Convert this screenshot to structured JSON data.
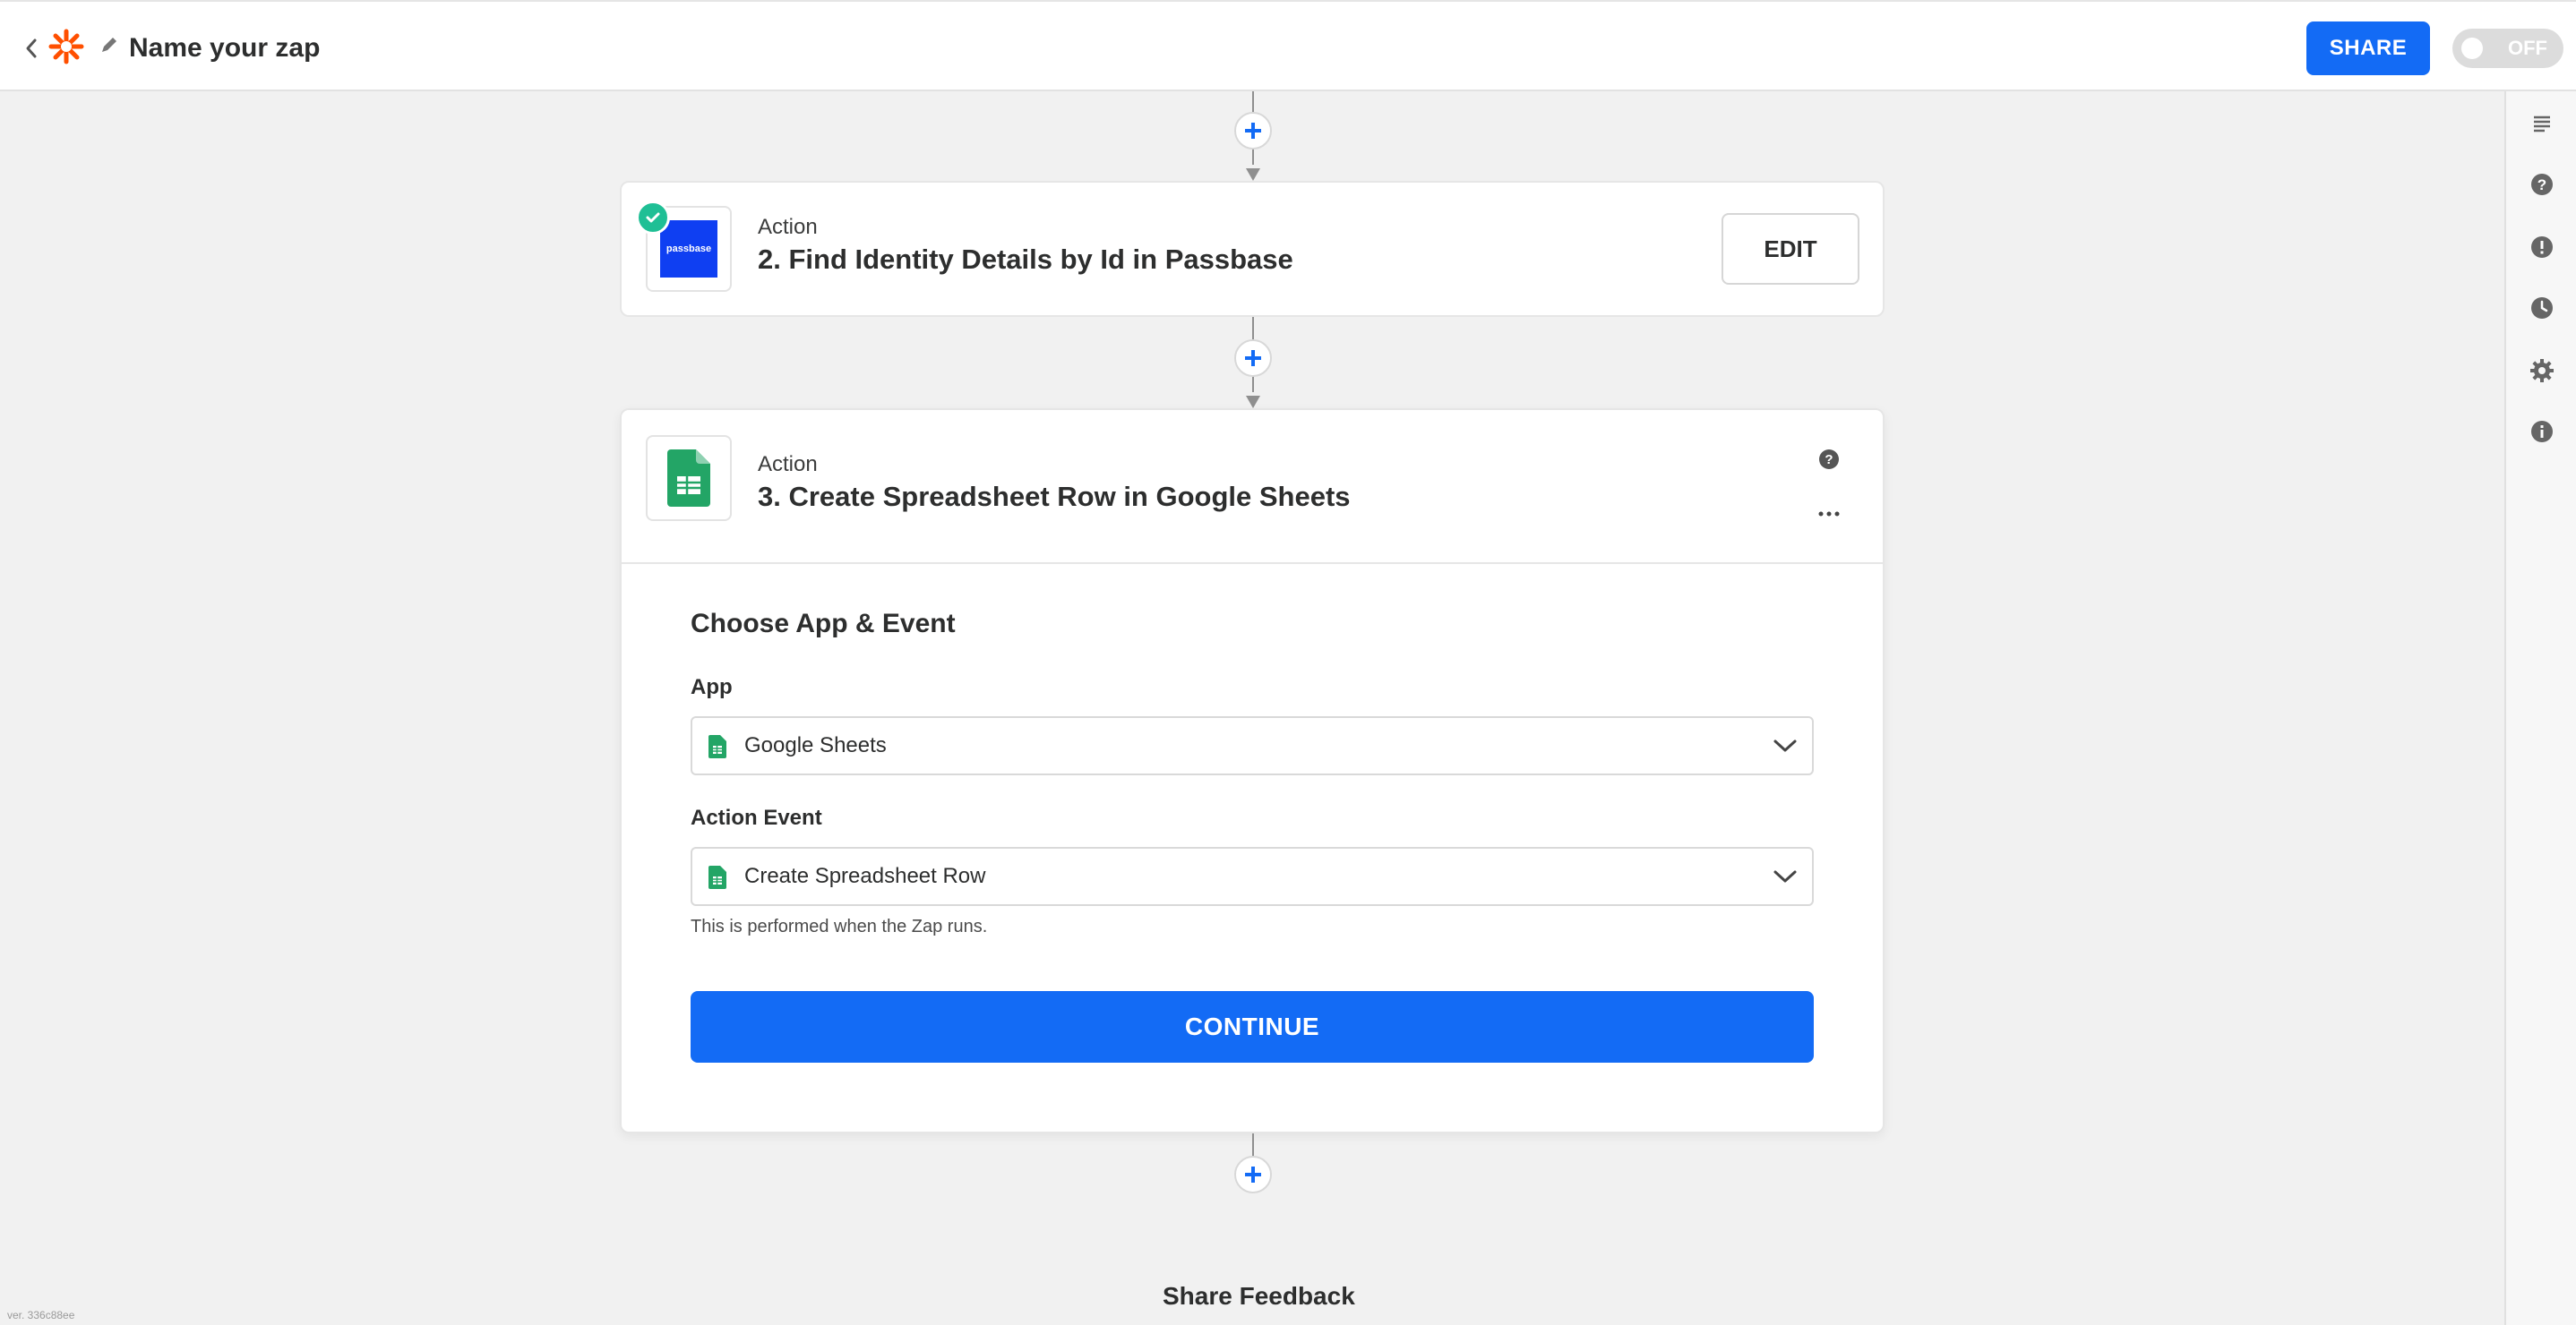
{
  "header": {
    "title": "Name your zap",
    "share_label": "SHARE",
    "toggle_label": "OFF",
    "accent": "#136bf5"
  },
  "steps": [
    {
      "type_label": "Action",
      "title": "2. Find Identity Details by Id in Passbase",
      "app_logo_text": "passbase",
      "status": "complete",
      "edit_label": "EDIT"
    },
    {
      "type_label": "Action",
      "title": "3. Create Spreadsheet Row in Google Sheets",
      "section_title": "Choose App & Event",
      "app_field": {
        "label": "App",
        "value": "Google Sheets"
      },
      "event_field": {
        "label": "Action Event",
        "value": "Create Spreadsheet Row",
        "hint": "This is performed when the Zap runs."
      },
      "continue_label": "CONTINUE"
    }
  ],
  "rail": {
    "items": [
      "outline-icon",
      "help-icon",
      "alert-icon",
      "history-icon",
      "settings-icon",
      "info-icon"
    ]
  },
  "footer": {
    "feedback_label": "Share Feedback",
    "version": "ver. 336c88ee"
  }
}
